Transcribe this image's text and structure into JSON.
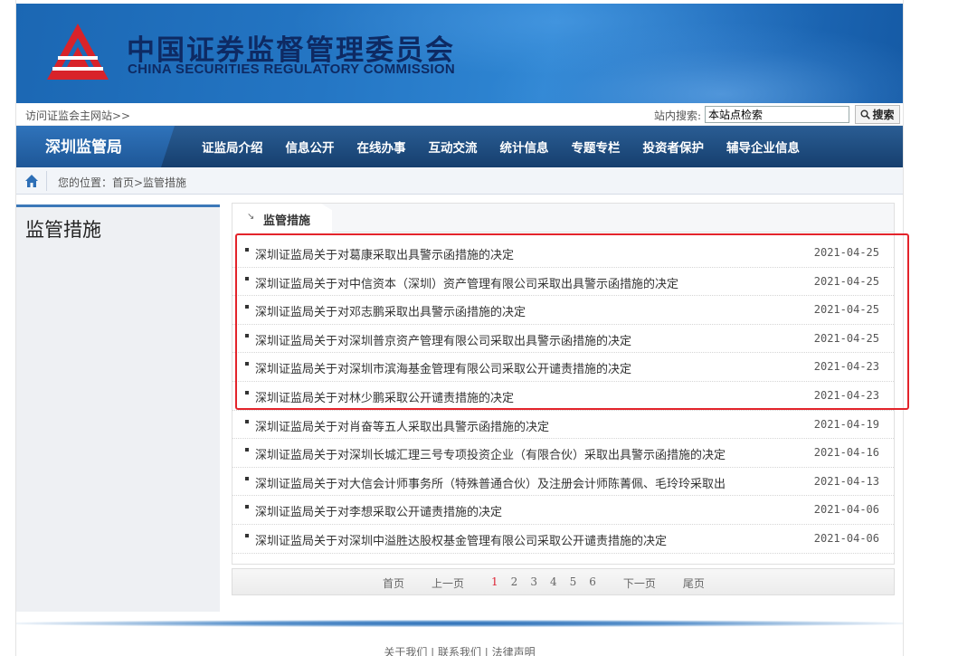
{
  "header": {
    "org_cn": "中国证券监督管理委员会",
    "org_en": "CHINA SECURITIES REGULATORY COMMISSION",
    "logo_color": "#d8232a"
  },
  "util": {
    "visit_link": "访问证监会主网站>>",
    "search_label": "站内搜索:",
    "search_value": "本站点检索",
    "search_button": "搜索"
  },
  "nav": {
    "branch": "深圳监管局",
    "items": [
      "证监局介绍",
      "信息公开",
      "在线办事",
      "互动交流",
      "统计信息",
      "专题专栏",
      "投资者保护",
      "辅导企业信息"
    ]
  },
  "breadcrumb": {
    "text": "您的位置：首页>监管措施"
  },
  "sidebar": {
    "title": "监管措施"
  },
  "panel": {
    "tab_label": "监管措施",
    "tab_arrow": "↘"
  },
  "articles": [
    {
      "title": "深圳证监局关于对葛康采取出具警示函措施的决定",
      "date": "2021-04-25"
    },
    {
      "title": "深圳证监局关于对中信资本（深圳）资产管理有限公司采取出具警示函措施的决定",
      "date": "2021-04-25"
    },
    {
      "title": "深圳证监局关于对邓志鹏采取出具警示函措施的决定",
      "date": "2021-04-25"
    },
    {
      "title": "深圳证监局关于对深圳普京资产管理有限公司采取出具警示函措施的决定",
      "date": "2021-04-25"
    },
    {
      "title": "深圳证监局关于对深圳市滨海基金管理有限公司采取公开谴责措施的决定",
      "date": "2021-04-23"
    },
    {
      "title": "深圳证监局关于对林少鹏采取公开谴责措施的决定",
      "date": "2021-04-23"
    },
    {
      "title": "深圳证监局关于对肖奋等五人采取出具警示函措施的决定",
      "date": "2021-04-19"
    },
    {
      "title": "深圳证监局关于对深圳长城汇理三号专项投资企业（有限合伙）采取出具警示函措施的决定",
      "date": "2021-04-16"
    },
    {
      "title": "深圳证监局关于对大信会计师事务所（特殊普通合伙）及注册会计师陈菁佩、毛玲玲采取出",
      "date": "2021-04-13"
    },
    {
      "title": "深圳证监局关于对李想采取公开谴责措施的决定",
      "date": "2021-04-06"
    },
    {
      "title": "深圳证监局关于对深圳中溢胜达股权基金管理有限公司采取公开谴责措施的决定",
      "date": "2021-04-06"
    }
  ],
  "pagination": {
    "first": "首页",
    "prev": "上一页",
    "pages": [
      "1",
      "2",
      "3",
      "4",
      "5",
      "6"
    ],
    "current": "1",
    "next": "下一页",
    "last": "尾页"
  },
  "footer": {
    "text": "关于我们 | 联系我们 | 法律声明"
  },
  "colors": {
    "nav_bg": "#1d4a7e",
    "highlight": "#e3242b",
    "current_page": "#d23"
  }
}
